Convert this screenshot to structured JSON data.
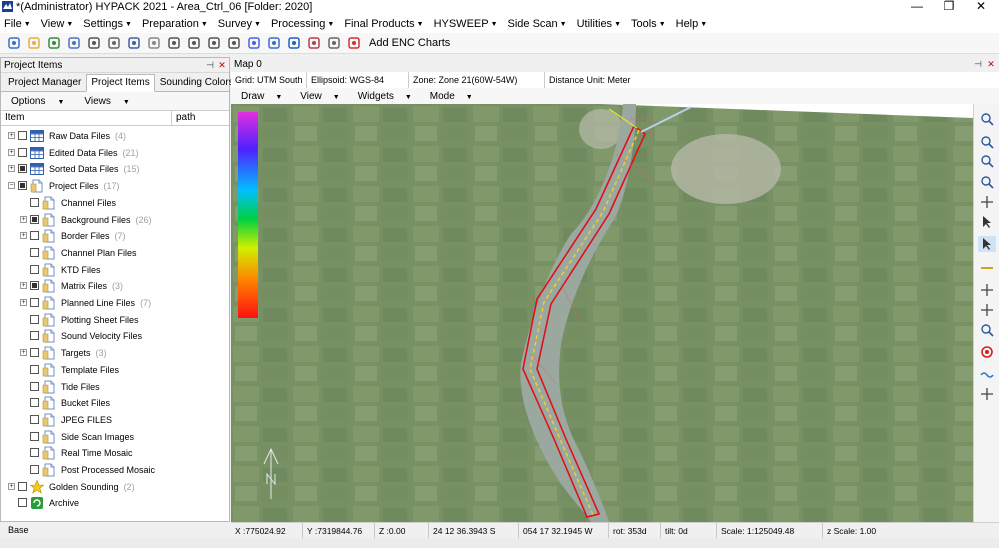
{
  "window": {
    "title": "*(Administrator) HYPACK 2021 - Area_Ctrl_06  [Folder: 2020]",
    "minimize": "—",
    "maximize": "❐",
    "close": "✕"
  },
  "menu": [
    "File",
    "View",
    "Settings",
    "Preparation",
    "Survey",
    "Processing",
    "Final Products",
    "HYSWEEP",
    "Side Scan",
    "Utilities",
    "Tools",
    "Help"
  ],
  "toolbar": {
    "icons": [
      "save-icon",
      "open-folder-icon",
      "globe-icon",
      "sphere-icon",
      "pin-icon",
      "pen-icon",
      "satellite-icon",
      "plot-icon",
      "curve-icon",
      "book-icon",
      "book-open-icon",
      "book-grid-icon",
      "survey-icon",
      "sweep-icon",
      "boat-icon",
      "mail-icon",
      "print-icon",
      "chart-mountain-icon"
    ],
    "add_enc_label": "Add ENC Charts"
  },
  "left_panel": {
    "title": "Project Items",
    "tabs": [
      "Project Manager",
      "Project Items",
      "Sounding Colors"
    ],
    "active_tab": 1,
    "options_label": "Options",
    "views_label": "Views",
    "columns": [
      "Item",
      "path"
    ],
    "tree": [
      {
        "label": "Raw Data Files",
        "count": "(4)",
        "level": 0,
        "expand": true,
        "check": "empty",
        "icon": "grid"
      },
      {
        "label": "Edited Data Files",
        "count": "(21)",
        "level": 0,
        "expand": true,
        "check": "empty",
        "icon": "grid"
      },
      {
        "label": "Sorted Data Files",
        "count": "(15)",
        "level": 0,
        "expand": true,
        "check": "partial",
        "icon": "grid"
      },
      {
        "label": "Project Files",
        "count": "(17)",
        "level": 0,
        "expand": "minus",
        "check": "partial",
        "icon": "doc"
      },
      {
        "label": "Channel Files",
        "count": "",
        "level": 1,
        "expand": false,
        "check": "empty",
        "icon": "doc"
      },
      {
        "label": "Background Files",
        "count": "(26)",
        "level": 1,
        "expand": true,
        "check": "partial",
        "icon": "doc"
      },
      {
        "label": "Border Files",
        "count": "(7)",
        "level": 1,
        "expand": true,
        "check": "empty",
        "icon": "doc"
      },
      {
        "label": "Channel Plan Files",
        "count": "",
        "level": 1,
        "expand": false,
        "check": "empty",
        "icon": "doc"
      },
      {
        "label": "KTD Files",
        "count": "",
        "level": 1,
        "expand": false,
        "check": "empty",
        "icon": "doc"
      },
      {
        "label": "Matrix Files",
        "count": "(3)",
        "level": 1,
        "expand": true,
        "check": "partial",
        "icon": "doc"
      },
      {
        "label": "Planned Line Files",
        "count": "(7)",
        "level": 1,
        "expand": true,
        "check": "empty",
        "icon": "doc"
      },
      {
        "label": "Plotting Sheet Files",
        "count": "",
        "level": 1,
        "expand": false,
        "check": "empty",
        "icon": "doc"
      },
      {
        "label": "Sound Velocity Files",
        "count": "",
        "level": 1,
        "expand": false,
        "check": "empty",
        "icon": "doc"
      },
      {
        "label": "Targets",
        "count": "(3)",
        "level": 1,
        "expand": true,
        "check": "empty",
        "icon": "doc"
      },
      {
        "label": "Template Files",
        "count": "",
        "level": 1,
        "expand": false,
        "check": "empty",
        "icon": "doc"
      },
      {
        "label": "Tide Files",
        "count": "",
        "level": 1,
        "expand": false,
        "check": "empty",
        "icon": "doc"
      },
      {
        "label": "Bucket Files",
        "count": "",
        "level": 1,
        "expand": false,
        "check": "empty",
        "icon": "doc"
      },
      {
        "label": "JPEG FILES",
        "count": "",
        "level": 1,
        "expand": false,
        "check": "empty",
        "icon": "doc"
      },
      {
        "label": "Side Scan Images",
        "count": "",
        "level": 1,
        "expand": false,
        "check": "empty",
        "icon": "doc"
      },
      {
        "label": "Real Time Mosaic",
        "count": "",
        "level": 1,
        "expand": false,
        "check": "empty",
        "icon": "doc"
      },
      {
        "label": "Post Processed Mosaic",
        "count": "",
        "level": 1,
        "expand": false,
        "check": "empty",
        "icon": "doc"
      },
      {
        "label": "Golden Sounding",
        "count": "(2)",
        "level": 0,
        "expand": true,
        "check": "empty",
        "icon": "star"
      },
      {
        "label": "Archive",
        "count": "",
        "level": 0,
        "expand": false,
        "check": "empty",
        "icon": "archive"
      }
    ],
    "base_label": "Base"
  },
  "map": {
    "title": "Map 0",
    "info": {
      "grid": "Grid: UTM South",
      "ellipsoid": "Ellipsoid: WGS-84",
      "zone": "Zone: Zone 21(60W-54W)",
      "unit": "Distance Unit: Meter"
    },
    "tools": [
      "Draw",
      "View",
      "Widgets",
      "Mode"
    ],
    "right_tools": [
      "zoom-extents-icon",
      "zoom-in-icon",
      "zoom-out-icon",
      "zoom-window-icon",
      "pan-hand-icon",
      "select-node-icon",
      "pointer-icon",
      "measure-line-icon",
      "north-arrow-icon",
      "rotate-icon",
      "zoom-center-icon",
      "target-icon",
      "wave-icon",
      "edit-icon"
    ],
    "north_label": "N"
  },
  "status": {
    "x": "X :775024.92",
    "y": "Y :7319844.76",
    "z": "Z :0.00",
    "lat": "24 12 36.3943 S",
    "lon": "054 17 32.1945 W",
    "rot": "rot: 353d",
    "tilt": "tilt:   0d",
    "scale": "Scale: 1:125049.48",
    "zscale": "z Scale: 1.00"
  },
  "colors": {
    "channel_border": "#e0101a",
    "centerline": "#f0d020",
    "water": "#9aa8a0"
  }
}
